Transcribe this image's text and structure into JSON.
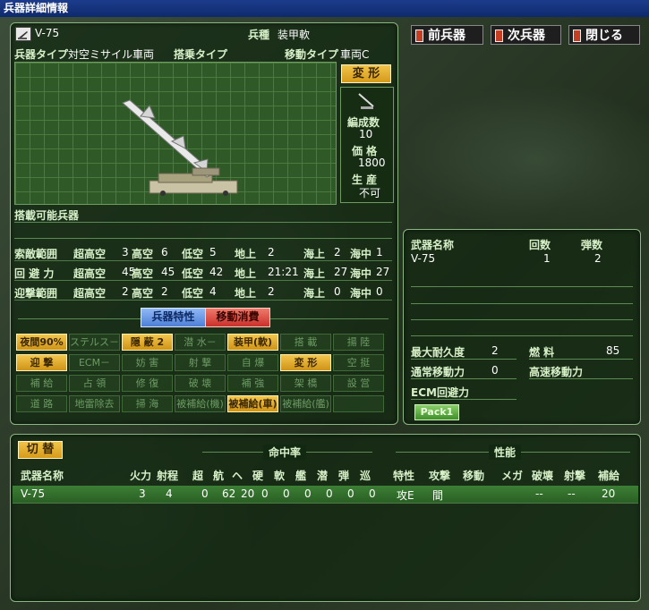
{
  "window": {
    "title": "兵器詳細情報"
  },
  "nav": {
    "prev": "前兵器",
    "next": "次兵器",
    "close": "閉じる"
  },
  "unit": {
    "name": "V-75",
    "type_label": "兵種",
    "type_value": "装甲軟",
    "weapon_type_label": "兵器タイプ",
    "weapon_type_value": "対空ミサイル車両",
    "carrier_type_label": "搭乗タイプ",
    "carrier_type_value": "",
    "move_type_label": "移動タイプ",
    "move_type_value": "車両C",
    "transform_btn": "変 形",
    "formation_label": "編成数",
    "formation_value": "10",
    "price_label": "価 格",
    "price_value": "1800",
    "production_label": "生 産",
    "production_value": "不可",
    "loadable_label": "搭載可能兵器"
  },
  "ranges": {
    "rows": [
      {
        "label": "索敵範囲",
        "cells": [
          [
            "超高空",
            "3"
          ],
          [
            "高空",
            "6"
          ],
          [
            "低空",
            "5"
          ],
          [
            "地上",
            "2"
          ],
          [
            "海上",
            "2"
          ],
          [
            "海中",
            "1"
          ]
        ]
      },
      {
        "label": "回 避 力",
        "cells": [
          [
            "超高空",
            "45"
          ],
          [
            "高空",
            "45"
          ],
          [
            "低空",
            "42"
          ],
          [
            "地上",
            "21:21"
          ],
          [
            "海上",
            "27"
          ],
          [
            "海中",
            "27"
          ]
        ]
      },
      {
        "label": "迎撃範囲",
        "cells": [
          [
            "超高空",
            "2"
          ],
          [
            "高空",
            "2"
          ],
          [
            "低空",
            "4"
          ],
          [
            "地上",
            "2"
          ],
          [
            "海上",
            "0"
          ],
          [
            "海中",
            "0"
          ]
        ]
      }
    ]
  },
  "tabs": {
    "traits": "兵器特性",
    "movecost": "移動消費"
  },
  "traits": [
    [
      {
        "t": "夜間90%",
        "on": true
      },
      {
        "t": "ステルス－",
        "on": false
      },
      {
        "t": "隠 蔽 2",
        "on": true
      },
      {
        "t": "潜 水－",
        "on": false
      },
      {
        "t": "装甲(軟)",
        "on": true
      },
      {
        "t": "搭 載",
        "on": false
      },
      {
        "t": "揚 陸",
        "on": false
      }
    ],
    [
      {
        "t": "迎 撃",
        "on": true
      },
      {
        "t": "ECM－",
        "on": false
      },
      {
        "t": "妨 害",
        "on": false
      },
      {
        "t": "射 撃",
        "on": false
      },
      {
        "t": "自 爆",
        "on": false
      },
      {
        "t": "変 形",
        "on": true
      },
      {
        "t": "空 挺",
        "on": false
      }
    ],
    [
      {
        "t": "補 給",
        "on": false
      },
      {
        "t": "占 領",
        "on": false
      },
      {
        "t": "修 復",
        "on": false
      },
      {
        "t": "破 壊",
        "on": false
      },
      {
        "t": "補 強",
        "on": false
      },
      {
        "t": "架 橋",
        "on": false
      },
      {
        "t": "設 営",
        "on": false
      }
    ],
    [
      {
        "t": "道 路",
        "on": false
      },
      {
        "t": "地雷除去",
        "on": false
      },
      {
        "t": "掃 海",
        "on": false
      },
      {
        "t": "被補給(機)",
        "on": false
      },
      {
        "t": "被補給(車)",
        "on": true
      },
      {
        "t": "被補給(艦)",
        "on": false
      },
      {
        "t": "",
        "on": false
      }
    ]
  ],
  "weapon_panel": {
    "hdr_name": "武器名称",
    "hdr_count": "回数",
    "hdr_ammo": "弾数",
    "rows": [
      {
        "name": "V-75",
        "count": "1",
        "ammo": "2"
      }
    ],
    "durability_label": "最大耐久度",
    "durability_value": "2",
    "fuel_label": "燃 料",
    "fuel_value": "85",
    "normal_move_label": "通常移動力",
    "normal_move_value": "0",
    "fast_move_label": "高速移動力",
    "fast_move_value": "",
    "ecm_label": "ECM回避力",
    "pack_label": "Pack1"
  },
  "weapons_table": {
    "switch_btn": "切 替",
    "group_hit": "命中率",
    "group_perf": "性能",
    "headers": [
      "武器名称",
      "火力",
      "射程",
      "超",
      "航",
      "ヘ",
      "硬",
      "軟",
      "艦",
      "潜",
      "弾",
      "巡",
      "特性",
      "攻撃",
      "移動",
      "メガ",
      "破壊",
      "射撃",
      "補給"
    ],
    "rows": [
      [
        "V-75",
        "3",
        "4",
        "0",
        "62",
        "20",
        "0",
        "0",
        "0",
        "0",
        "0",
        "0",
        "攻E",
        "間",
        "",
        "",
        "--",
        "--",
        "20"
      ]
    ]
  }
}
